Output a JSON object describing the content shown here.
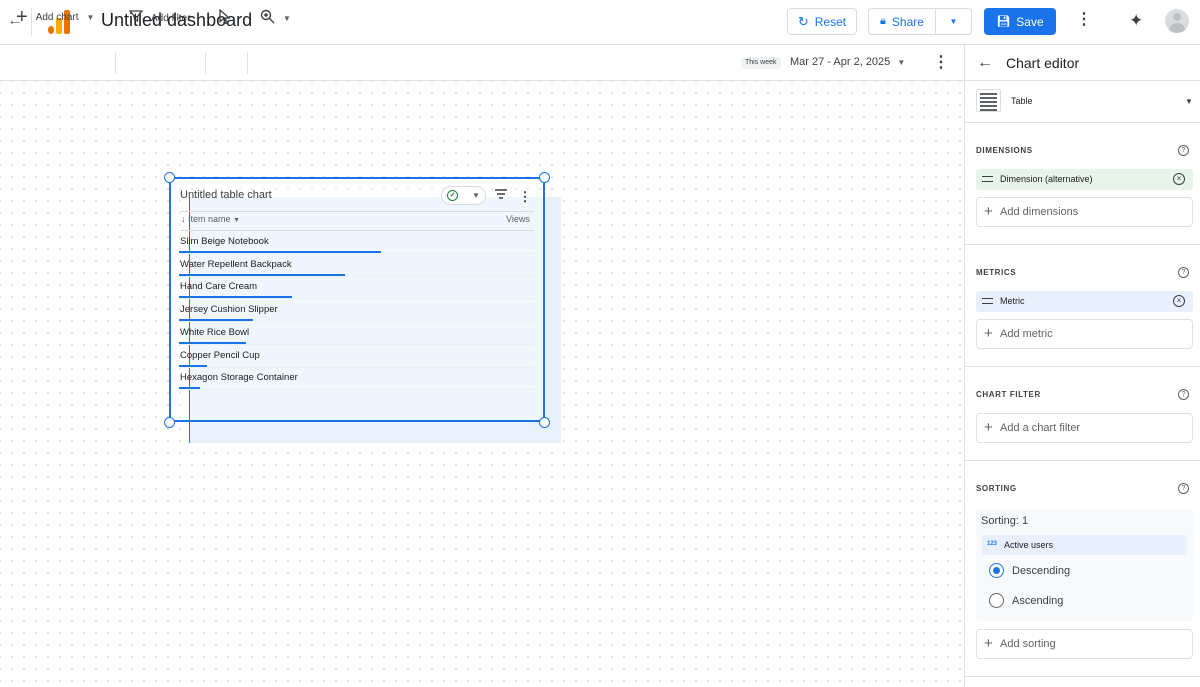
{
  "header": {
    "title": "Untitled dashboard",
    "reset_label": "Reset",
    "share_label": "Share",
    "save_label": "Save"
  },
  "toolbar": {
    "add_chart_label": "Add chart",
    "add_filter_label": "Add filter",
    "date_chip": "This week",
    "date_range": "Mar 27 - Apr 2, 2025"
  },
  "chart": {
    "title": "Untitled table chart",
    "columns": {
      "dimension": "Item name",
      "metric": "Views"
    },
    "rows": [
      {
        "label": "Slim Beige Notebook",
        "bar_fraction": 0.57
      },
      {
        "label": "Water Repellent Backpack",
        "bar_fraction": 0.47
      },
      {
        "label": "Hand Care Cream",
        "bar_fraction": 0.32
      },
      {
        "label": "Jersey Cushion Slipper",
        "bar_fraction": 0.21
      },
      {
        "label": "White Rice Bowl",
        "bar_fraction": 0.19
      },
      {
        "label": "Copper Pencil Cup",
        "bar_fraction": 0.08
      },
      {
        "label": "Hexagon Storage Container",
        "bar_fraction": 0.06
      }
    ]
  },
  "editor": {
    "title": "Chart editor",
    "chart_type": "Table",
    "dimensions": {
      "label": "DIMENSIONS",
      "chip": "Dimension (alternative)",
      "add_label": "Add dimensions"
    },
    "metrics": {
      "label": "METRICS",
      "chip": "Metric",
      "add_label": "Add metric"
    },
    "chart_filter": {
      "label": "CHART FILTER",
      "add_label": "Add a chart filter"
    },
    "sorting": {
      "label": "SORTING",
      "title": "Sorting: 1",
      "metric_icon": "123",
      "metric": "Active users",
      "descending_label": "Descending",
      "ascending_label": "Ascending",
      "selected": "Descending",
      "add_label": "Add sorting"
    }
  },
  "colors": {
    "accent": "#1a73e8",
    "logo_orange": "#f9ab00",
    "logo_dark": "#e37400",
    "success": "#188038"
  }
}
